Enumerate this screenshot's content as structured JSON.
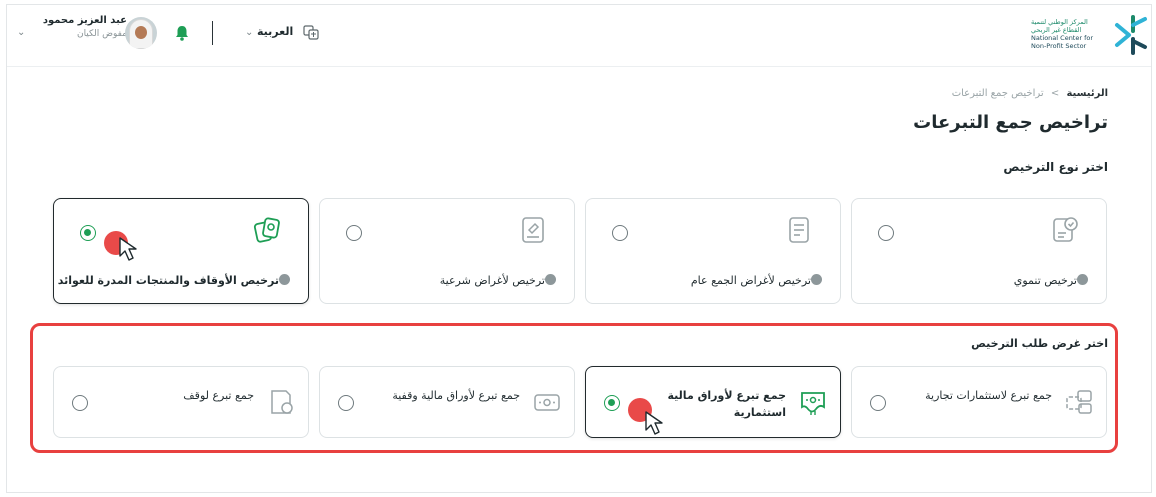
{
  "header": {
    "user_name": "عبد العزيز محمود",
    "user_role": "مفوض الكيان",
    "language": "العربية",
    "logo_lines": [
      "المركز الوطني لتنمية",
      "القطاع غير الربحي",
      "National Center for",
      "Non-Profit Sector"
    ]
  },
  "breadcrumb": {
    "home": "الرئيسية",
    "separator": ">",
    "current": "تراخيص جمع التبرعات"
  },
  "page_title": "تراخيص جمع التبرعات",
  "license_type": {
    "title": "اختر نوع الترخيص",
    "options": [
      {
        "label": "ترخيص تنموي",
        "selected": false,
        "icon": "developmental-license-icon"
      },
      {
        "label": "ترخيص لأغراض الجمع عام",
        "selected": false,
        "icon": "document-icon"
      },
      {
        "label": "ترخيص لأغراض شرعية",
        "selected": false,
        "icon": "sharia-license-icon"
      },
      {
        "label": "ترخيص الأوقاف والمنتجات المدرة للعوائد",
        "selected": true,
        "icon": "endowment-cards-icon"
      }
    ]
  },
  "license_purpose": {
    "title": "اختر غرض طلب الترخيص",
    "options": [
      {
        "label": "جمع تبرع لاستثمارات تجارية",
        "selected": false,
        "icon": "commercial-investment-icon"
      },
      {
        "label": "جمع تبرع لأوراق مالية استثمارية",
        "selected": true,
        "icon": "investment-securities-icon"
      },
      {
        "label": "جمع تبرع لأوراق مالية وقفية",
        "selected": false,
        "icon": "endowment-securities-icon"
      },
      {
        "label": "جمع تبرع لوقف",
        "selected": false,
        "icon": "endowment-icon"
      }
    ]
  },
  "colors": {
    "accent_green": "#1e9e55",
    "highlight_red": "#e8403f",
    "brand_teal": "#1e4a5a"
  }
}
